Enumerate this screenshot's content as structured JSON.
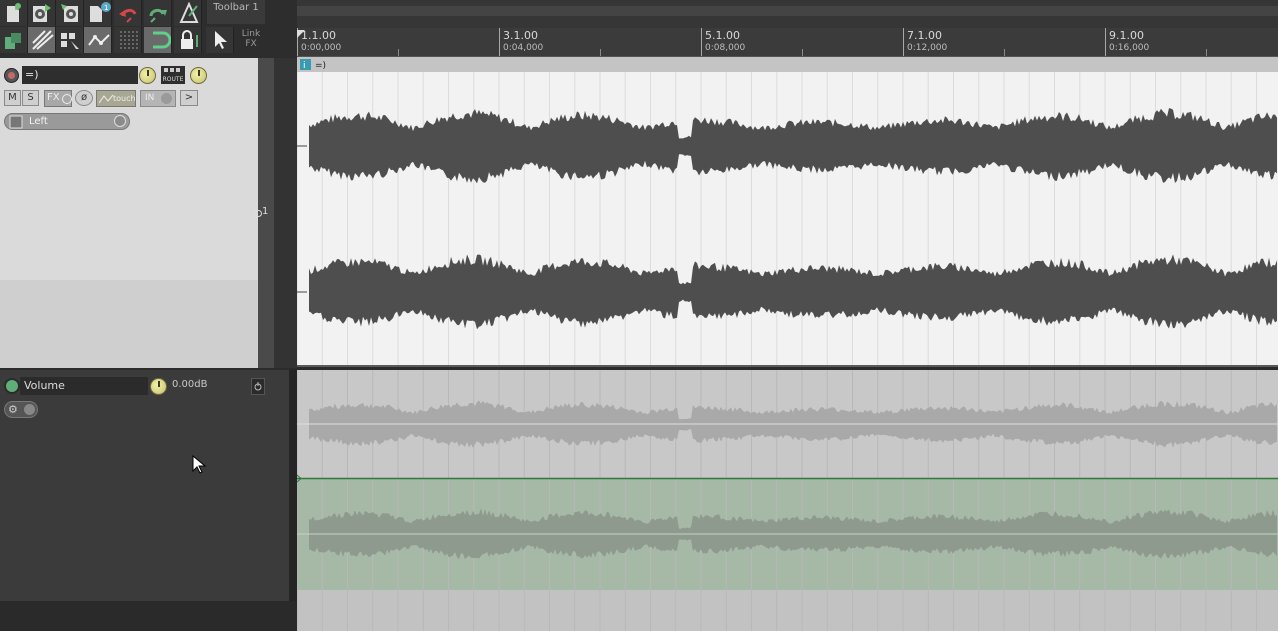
{
  "toolbar": {
    "title": "Toolbar 1",
    "link_fx": "Link FX",
    "colors": {
      "bg": "#2d2d2d",
      "icon_green": "#5fae7a",
      "icon_red": "#d24747"
    }
  },
  "ruler": {
    "marks": [
      {
        "measure": "1.1.00",
        "time": "0:00,000"
      },
      {
        "measure": "3.1.00",
        "time": "0:04,000"
      },
      {
        "measure": "5.1.00",
        "time": "0:08,000"
      },
      {
        "measure": "7.1.00",
        "time": "0:12,000"
      },
      {
        "measure": "9.1.00",
        "time": "0:16,000"
      }
    ]
  },
  "track": {
    "name": "=)",
    "number": "1",
    "mute": "M",
    "solo": "S",
    "fx": "FX",
    "automation_mode": "touch",
    "input_label": "IN",
    "input_channel": "Left",
    "route": "ROUTE",
    "item_name": "=)",
    "item_badge": "i"
  },
  "envelope": {
    "name": "Volume",
    "value": "0.00dB"
  },
  "icons": [
    "new-project-icon",
    "open-project-icon",
    "save-icon",
    "project-settings-icon",
    "undo-icon",
    "redo-icon",
    "metronome-icon",
    "trim-icon",
    "ripple-icon",
    "grid-icon",
    "envelope-icon",
    "snap-icon",
    "lock-icon",
    "cursor-icon",
    "record-arm-icon",
    "settings-icon"
  ]
}
